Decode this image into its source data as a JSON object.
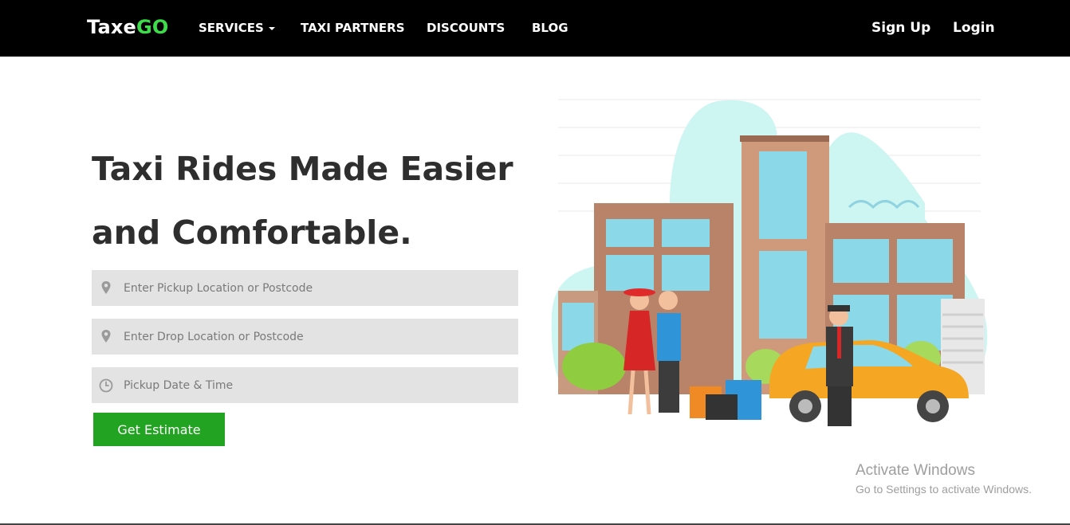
{
  "brand": {
    "name_part1": "Taxe",
    "name_part2": "GO",
    "accent": "#3ddc4a"
  },
  "nav": {
    "services": "SERVICES",
    "taxi_partners": "TAXI PARTNERS",
    "discounts": "DISCOUNTS",
    "blog": "BLOG",
    "sign_up": "Sign Up",
    "login": "Login"
  },
  "hero": {
    "title_line1": "Taxi Rides Made Easier",
    "title_line2": "and Comfortable."
  },
  "form": {
    "pickup_placeholder": "Enter Pickup Location or Postcode",
    "drop_placeholder": "Enter Drop Location or Postcode",
    "datetime_placeholder": "Pickup Date & Time",
    "button_label": "Get Estimate",
    "button_color": "#22a322",
    "location_icon": "map-marker-icon",
    "clock_icon": "clock-icon"
  },
  "illustration": "taxi-illustration",
  "windows_watermark": {
    "title": "Activate Windows",
    "subtitle": "Go to Settings to activate Windows."
  }
}
